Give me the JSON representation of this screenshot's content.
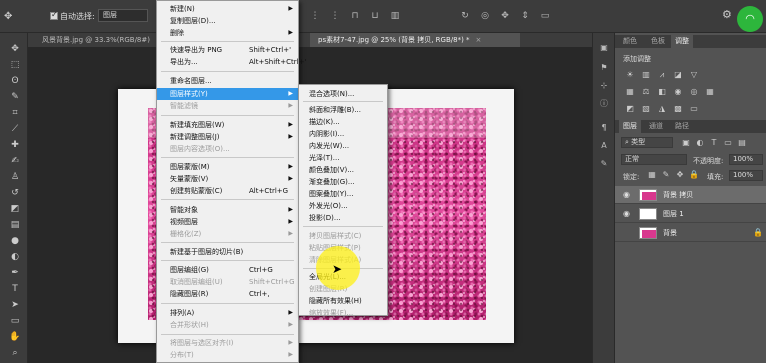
{
  "options_bar": {
    "auto_select_label": "自动选择:",
    "auto_select_value": "图层"
  },
  "tabs": [
    {
      "label": "风景背景.jpg @ 33.3%(RGB/8#)",
      "close": "×"
    },
    {
      "label": "ps素材7-47.jpg @ 25% (背景 拷贝, RGB/8*) *",
      "close": "×"
    }
  ],
  "layer_menu": {
    "items": [
      {
        "label": "新建(N)",
        "shortcut": "",
        "submenu": true,
        "disabled": false
      },
      {
        "label": "复制图层(D)...",
        "shortcut": "",
        "submenu": false,
        "disabled": false
      },
      {
        "label": "删除",
        "shortcut": "",
        "submenu": true,
        "disabled": false
      },
      {
        "label": "快速导出为 PNG",
        "shortcut": "Shift+Ctrl+'",
        "submenu": false,
        "disabled": false
      },
      {
        "label": "导出为...",
        "shortcut": "Alt+Shift+Ctrl+'",
        "submenu": false,
        "disabled": false
      },
      {
        "label": "重命名图层...",
        "shortcut": "",
        "submenu": false,
        "disabled": false
      },
      {
        "label": "图层样式(Y)",
        "shortcut": "",
        "submenu": true,
        "disabled": false,
        "highlighted": true
      },
      {
        "label": "智能滤镜",
        "shortcut": "",
        "submenu": true,
        "disabled": true
      },
      {
        "label": "新建填充图层(W)",
        "shortcut": "",
        "submenu": true,
        "disabled": false
      },
      {
        "label": "新建调整图层(J)",
        "shortcut": "",
        "submenu": true,
        "disabled": false
      },
      {
        "label": "图层内容选项(O)...",
        "shortcut": "",
        "submenu": false,
        "disabled": true
      },
      {
        "label": "图层蒙版(M)",
        "shortcut": "",
        "submenu": true,
        "disabled": false
      },
      {
        "label": "矢量蒙版(V)",
        "shortcut": "",
        "submenu": true,
        "disabled": false
      },
      {
        "label": "创建剪贴蒙版(C)",
        "shortcut": "Alt+Ctrl+G",
        "submenu": false,
        "disabled": false
      },
      {
        "label": "智能对象",
        "shortcut": "",
        "submenu": true,
        "disabled": false
      },
      {
        "label": "视频图层",
        "shortcut": "",
        "submenu": true,
        "disabled": false
      },
      {
        "label": "栅格化(Z)",
        "shortcut": "",
        "submenu": true,
        "disabled": true
      },
      {
        "label": "新建基于图层的切片(B)",
        "shortcut": "",
        "submenu": false,
        "disabled": false
      },
      {
        "label": "图层编组(G)",
        "shortcut": "Ctrl+G",
        "submenu": false,
        "disabled": false
      },
      {
        "label": "取消图层编组(U)",
        "shortcut": "Shift+Ctrl+G",
        "submenu": false,
        "disabled": true
      },
      {
        "label": "隐藏图层(R)",
        "shortcut": "Ctrl+,",
        "submenu": false,
        "disabled": false
      },
      {
        "label": "排列(A)",
        "shortcut": "",
        "submenu": true,
        "disabled": false
      },
      {
        "label": "合并形状(H)",
        "shortcut": "",
        "submenu": true,
        "disabled": true
      },
      {
        "label": "将图层与选区对齐(I)",
        "shortcut": "",
        "submenu": true,
        "disabled": true
      },
      {
        "label": "分布(T)",
        "shortcut": "",
        "submenu": true,
        "disabled": true
      }
    ]
  },
  "style_menu": {
    "items": [
      {
        "label": "混合选项(N)...",
        "disabled": false
      },
      {
        "label": "斜面和浮雕(B)...",
        "disabled": false
      },
      {
        "label": "描边(K)...",
        "disabled": false
      },
      {
        "label": "内阴影(I)...",
        "disabled": false
      },
      {
        "label": "内发光(W)...",
        "disabled": false
      },
      {
        "label": "光泽(T)...",
        "disabled": false
      },
      {
        "label": "颜色叠加(V)...",
        "disabled": false
      },
      {
        "label": "渐变叠加(G)...",
        "disabled": false
      },
      {
        "label": "图案叠加(Y)...",
        "disabled": false
      },
      {
        "label": "外发光(O)...",
        "disabled": false
      },
      {
        "label": "投影(D)...",
        "disabled": false
      },
      {
        "label": "拷贝图层样式(C)",
        "disabled": true
      },
      {
        "label": "粘贴图层样式(P)",
        "disabled": true
      },
      {
        "label": "清除图层样式(A)",
        "disabled": true
      },
      {
        "label": "全局光(L)...",
        "disabled": false
      },
      {
        "label": "创建图层(R)",
        "disabled": true
      },
      {
        "label": "隐藏所有效果(H)",
        "disabled": false
      },
      {
        "label": "缩放效果(F)...",
        "disabled": true
      }
    ]
  },
  "panels": {
    "top_tabs": [
      "颜色",
      "色板",
      "调整"
    ],
    "adjust_label": "添加调整",
    "layer_tabs": [
      "图层",
      "通道",
      "路径"
    ],
    "kind": "类型",
    "blend_mode": "正常",
    "opacity_label": "不透明度:",
    "opacity_value": "100%",
    "lock_label": "锁定:",
    "fill_label": "填充:",
    "fill_value": "100%",
    "layers": [
      {
        "name": "背景 拷贝",
        "selected": true,
        "locked": false
      },
      {
        "name": "图层 1",
        "selected": false,
        "locked": false
      },
      {
        "name": "背景",
        "selected": false,
        "locked": true
      }
    ]
  },
  "colors": {
    "menu_highlight": "#3498e8",
    "wifi_badge": "#2db63c",
    "cursor_highlight": "#ffef14",
    "flower_pink": "#d8388e"
  }
}
